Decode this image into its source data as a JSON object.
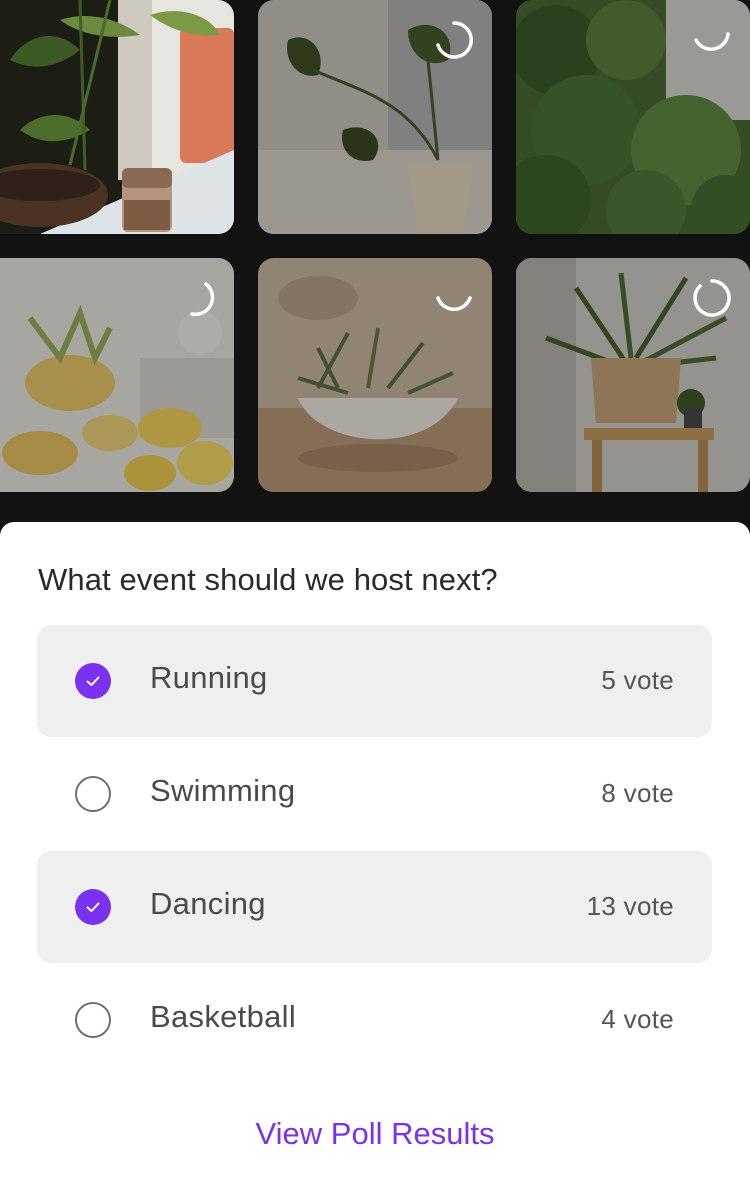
{
  "media": {
    "tiles": [
      {
        "subject": "plant with iced coffee",
        "state": "selected"
      },
      {
        "subject": "monstera in pot",
        "state": "loading"
      },
      {
        "subject": "leafy green shrubs",
        "state": "loading"
      },
      {
        "subject": "sliced pineapple",
        "state": "loading"
      },
      {
        "subject": "air plant in shell",
        "state": "loading"
      },
      {
        "subject": "spiky plant on wooden stand",
        "state": "loading"
      }
    ]
  },
  "poll": {
    "question": "What event should we host next?",
    "options": [
      {
        "label": "Running",
        "votes": "5 vote",
        "checked": true
      },
      {
        "label": "Swimming",
        "votes": "8 vote",
        "checked": false
      },
      {
        "label": "Dancing",
        "votes": "13 vote",
        "checked": true
      },
      {
        "label": "Basketball",
        "votes": "4 vote",
        "checked": false
      }
    ],
    "view_results_label": "View Poll Results"
  },
  "colors": {
    "accent": "#7a31f0",
    "selected_row_bg": "#efefef",
    "background": "#121212"
  }
}
